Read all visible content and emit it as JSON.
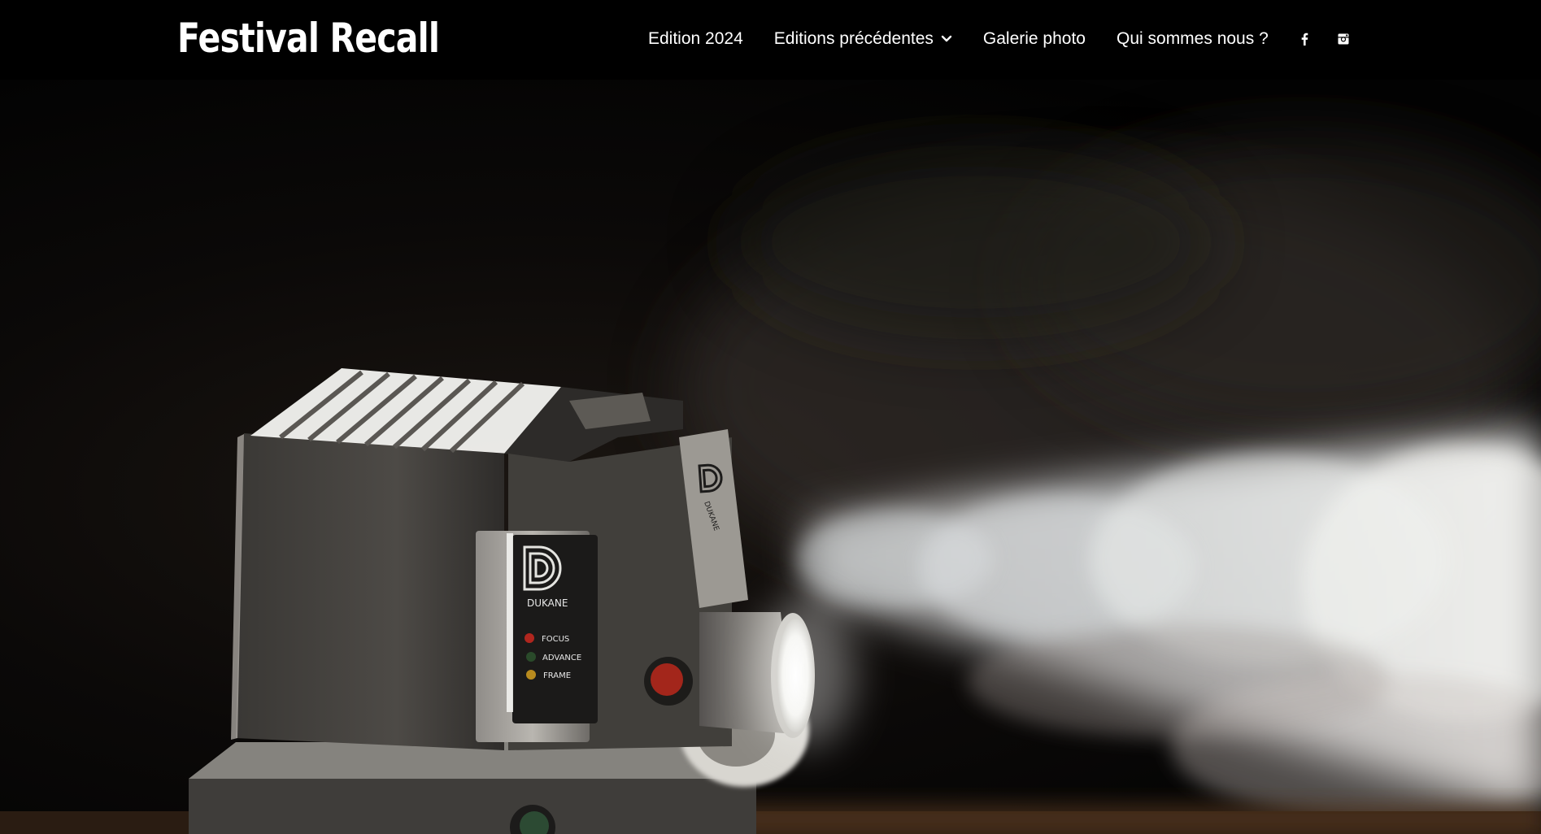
{
  "site": {
    "logo": "Festival Recall"
  },
  "nav": {
    "items": [
      {
        "label": "Edition 2024"
      },
      {
        "label": "Editions précédentes",
        "has_dropdown": true
      },
      {
        "label": "Galerie photo"
      },
      {
        "label": "Qui sommes nous ?"
      }
    ],
    "social": [
      {
        "icon": "facebook-icon"
      },
      {
        "icon": "instagram-icon"
      }
    ]
  },
  "hero": {
    "image": "vintage-projector-with-light-beam",
    "projector_brand": "DUKANE",
    "side_brand": "DUKANE",
    "controls": [
      "FOCUS",
      "ADVANCE",
      "FRAME"
    ]
  },
  "colors": {
    "header_bg": "#000000",
    "text": "#ffffff"
  }
}
